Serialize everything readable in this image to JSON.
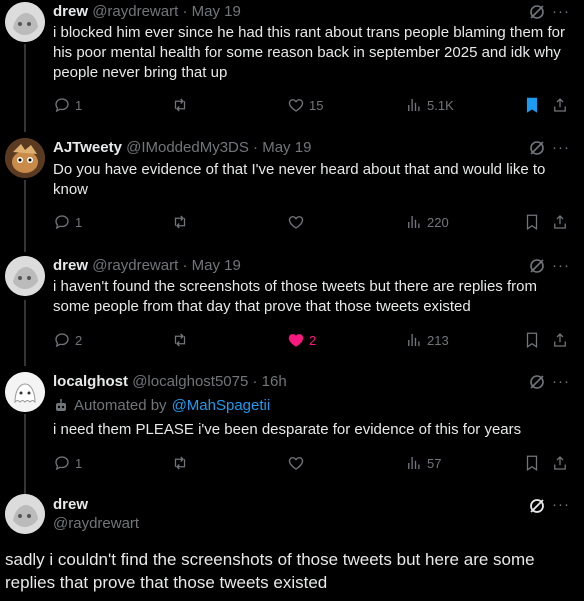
{
  "posts": [
    {
      "name": "drew",
      "handle": "@raydrewart",
      "sep": "·",
      "time": "May 19",
      "text": "i blocked him ever since he had this rant about trans people blaming them for his poor mental health for some reason back in september 2025 and idk why people never bring that up",
      "replies": "1",
      "reposts": "",
      "likes": "15",
      "views": "5.1K",
      "bookmarked": true
    },
    {
      "name": "AJTweety",
      "handle": "@IModdedMy3DS",
      "sep": "·",
      "time": "May 19",
      "text": "Do you have evidence of that I've never heard about that and would like to know",
      "replies": "1",
      "reposts": "",
      "likes": "",
      "views": "220",
      "bookmarked": false
    },
    {
      "name": "drew",
      "handle": "@raydrewart",
      "sep": "·",
      "time": "May 19",
      "text": "i haven't found the screenshots of those tweets but there are replies from some people from that day that prove that those tweets existed",
      "replies": "2",
      "reposts": "",
      "likes": "2",
      "views": "213",
      "liked": true,
      "bookmarked": false
    },
    {
      "name": "localghost",
      "handle": "@localghost5075",
      "sep": "·",
      "time": "16h",
      "automated_prefix": "Automated by",
      "automated_by": "@MahSpagetii",
      "text": "i need them PLEASE i've been desparate for evidence of this for years",
      "replies": "1",
      "reposts": "",
      "likes": "",
      "views": "57",
      "bookmarked": false
    }
  ],
  "focus": {
    "name": "drew",
    "handle": "@raydrewart",
    "text": "sadly i couldn't find the screenshots of those tweets but here are some replies that prove that those tweets existed"
  },
  "more_label": "···",
  "colors": {
    "accent": "#1d9bf0",
    "like": "#f91880",
    "muted": "#71767b",
    "text": "#e7e9ea",
    "background": "#000000"
  },
  "icons": [
    "reply-icon",
    "repost-icon",
    "like-icon",
    "views-icon",
    "bookmark-icon",
    "share-icon",
    "grok-icon",
    "more-icon",
    "robot-icon"
  ]
}
